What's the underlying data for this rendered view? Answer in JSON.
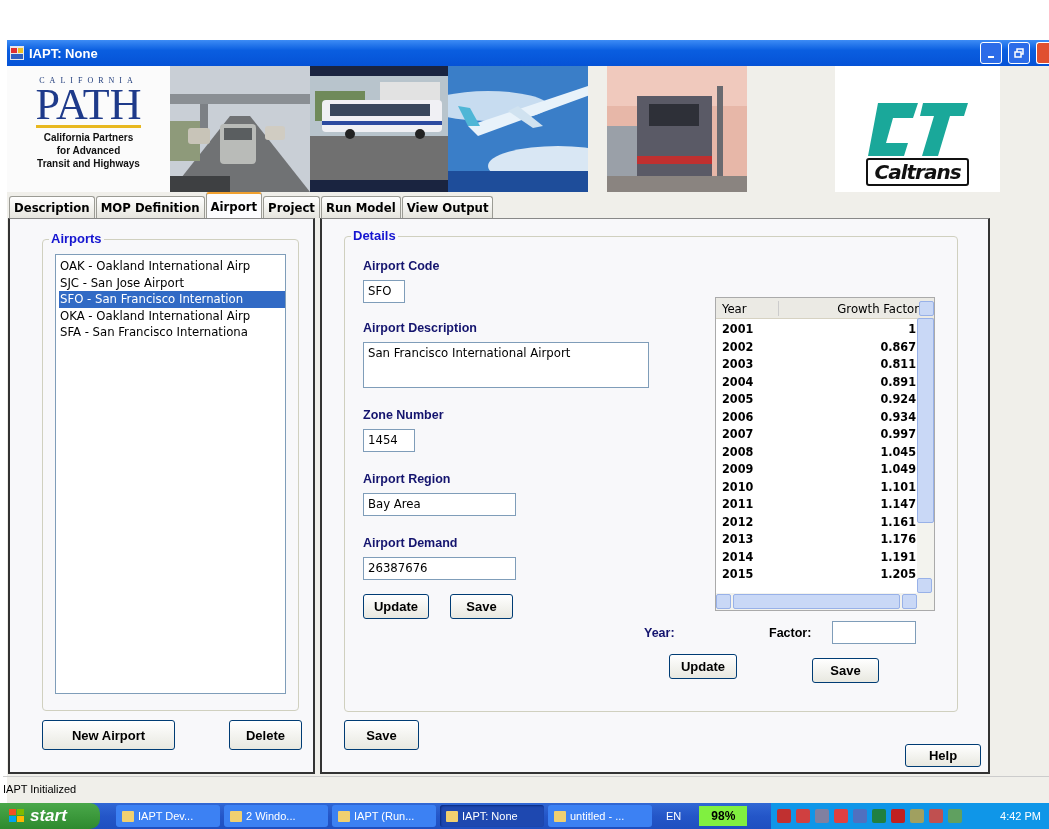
{
  "window": {
    "title": "IAPT: None"
  },
  "banner": {
    "logo": {
      "arc": "CALIFORNIA",
      "name": "PATH",
      "lines": [
        "California Partners",
        "for Advanced",
        "Transit and Highways"
      ]
    },
    "agency": "Caltrans"
  },
  "tabs": [
    {
      "label": "Description",
      "selected": false
    },
    {
      "label": "MOP Definition",
      "selected": false
    },
    {
      "label": "Airport",
      "selected": true
    },
    {
      "label": "Project",
      "selected": false
    },
    {
      "label": "Run Model",
      "selected": false
    },
    {
      "label": "View Output",
      "selected": false
    }
  ],
  "airports": {
    "title": "Airports",
    "items": [
      {
        "label": "OAK - Oakland International Airp",
        "selected": false
      },
      {
        "label": "SJC - San Jose Airport",
        "selected": false
      },
      {
        "label": "SFO - San Francisco Internation",
        "selected": true
      },
      {
        "label": "OKA - Oakland International Airp",
        "selected": false
      },
      {
        "label": "SFA - San Francisco Internationa",
        "selected": false
      }
    ],
    "buttons": [
      "New Airport",
      "Delete"
    ]
  },
  "details": {
    "title": "Details",
    "fields": [
      {
        "label": "Airport Code",
        "value": "SFO",
        "kind": "input"
      },
      {
        "label": "Airport Description",
        "value": "San Francisco International Airport",
        "kind": "textarea"
      },
      {
        "label": "Zone Number",
        "value": "1454",
        "kind": "input"
      },
      {
        "label": "Airport Region",
        "value": "Bay Area",
        "kind": "input"
      },
      {
        "label": "Airport Demand",
        "value": "26387676",
        "kind": "input"
      }
    ],
    "field_buttons": [
      "Update",
      "Save"
    ],
    "table": {
      "columns": [
        "Year",
        "Growth Factor"
      ],
      "rows": [
        [
          "2001",
          "1"
        ],
        [
          "2002",
          "0.867"
        ],
        [
          "2003",
          "0.811"
        ],
        [
          "2004",
          "0.891"
        ],
        [
          "2005",
          "0.924"
        ],
        [
          "2006",
          "0.934"
        ],
        [
          "2007",
          "0.997"
        ],
        [
          "2008",
          "1.045"
        ],
        [
          "2009",
          "1.049"
        ],
        [
          "2010",
          "1.101"
        ],
        [
          "2011",
          "1.147"
        ],
        [
          "2012",
          "1.161"
        ],
        [
          "2013",
          "1.176"
        ],
        [
          "2014",
          "1.191"
        ],
        [
          "2015",
          "1.205"
        ]
      ]
    },
    "year_label": "Year:",
    "factor_label": "Factor:",
    "table_buttons": [
      "Update",
      "Save"
    ]
  },
  "save_button": "Save",
  "help_button": "Help",
  "status_bar": "IAPT Initialized",
  "taskbar": {
    "start": "start",
    "tasks": [
      {
        "label": "IAPT Dev...",
        "selected": false
      },
      {
        "label": "2 Windo...",
        "selected": false
      },
      {
        "label": "IAPT (Run...",
        "selected": false
      },
      {
        "label": "IAPT: None",
        "selected": true
      },
      {
        "label": "untitled - ...",
        "selected": false
      }
    ],
    "language": "EN",
    "battery": "98%",
    "clock": "4:42 PM"
  }
}
